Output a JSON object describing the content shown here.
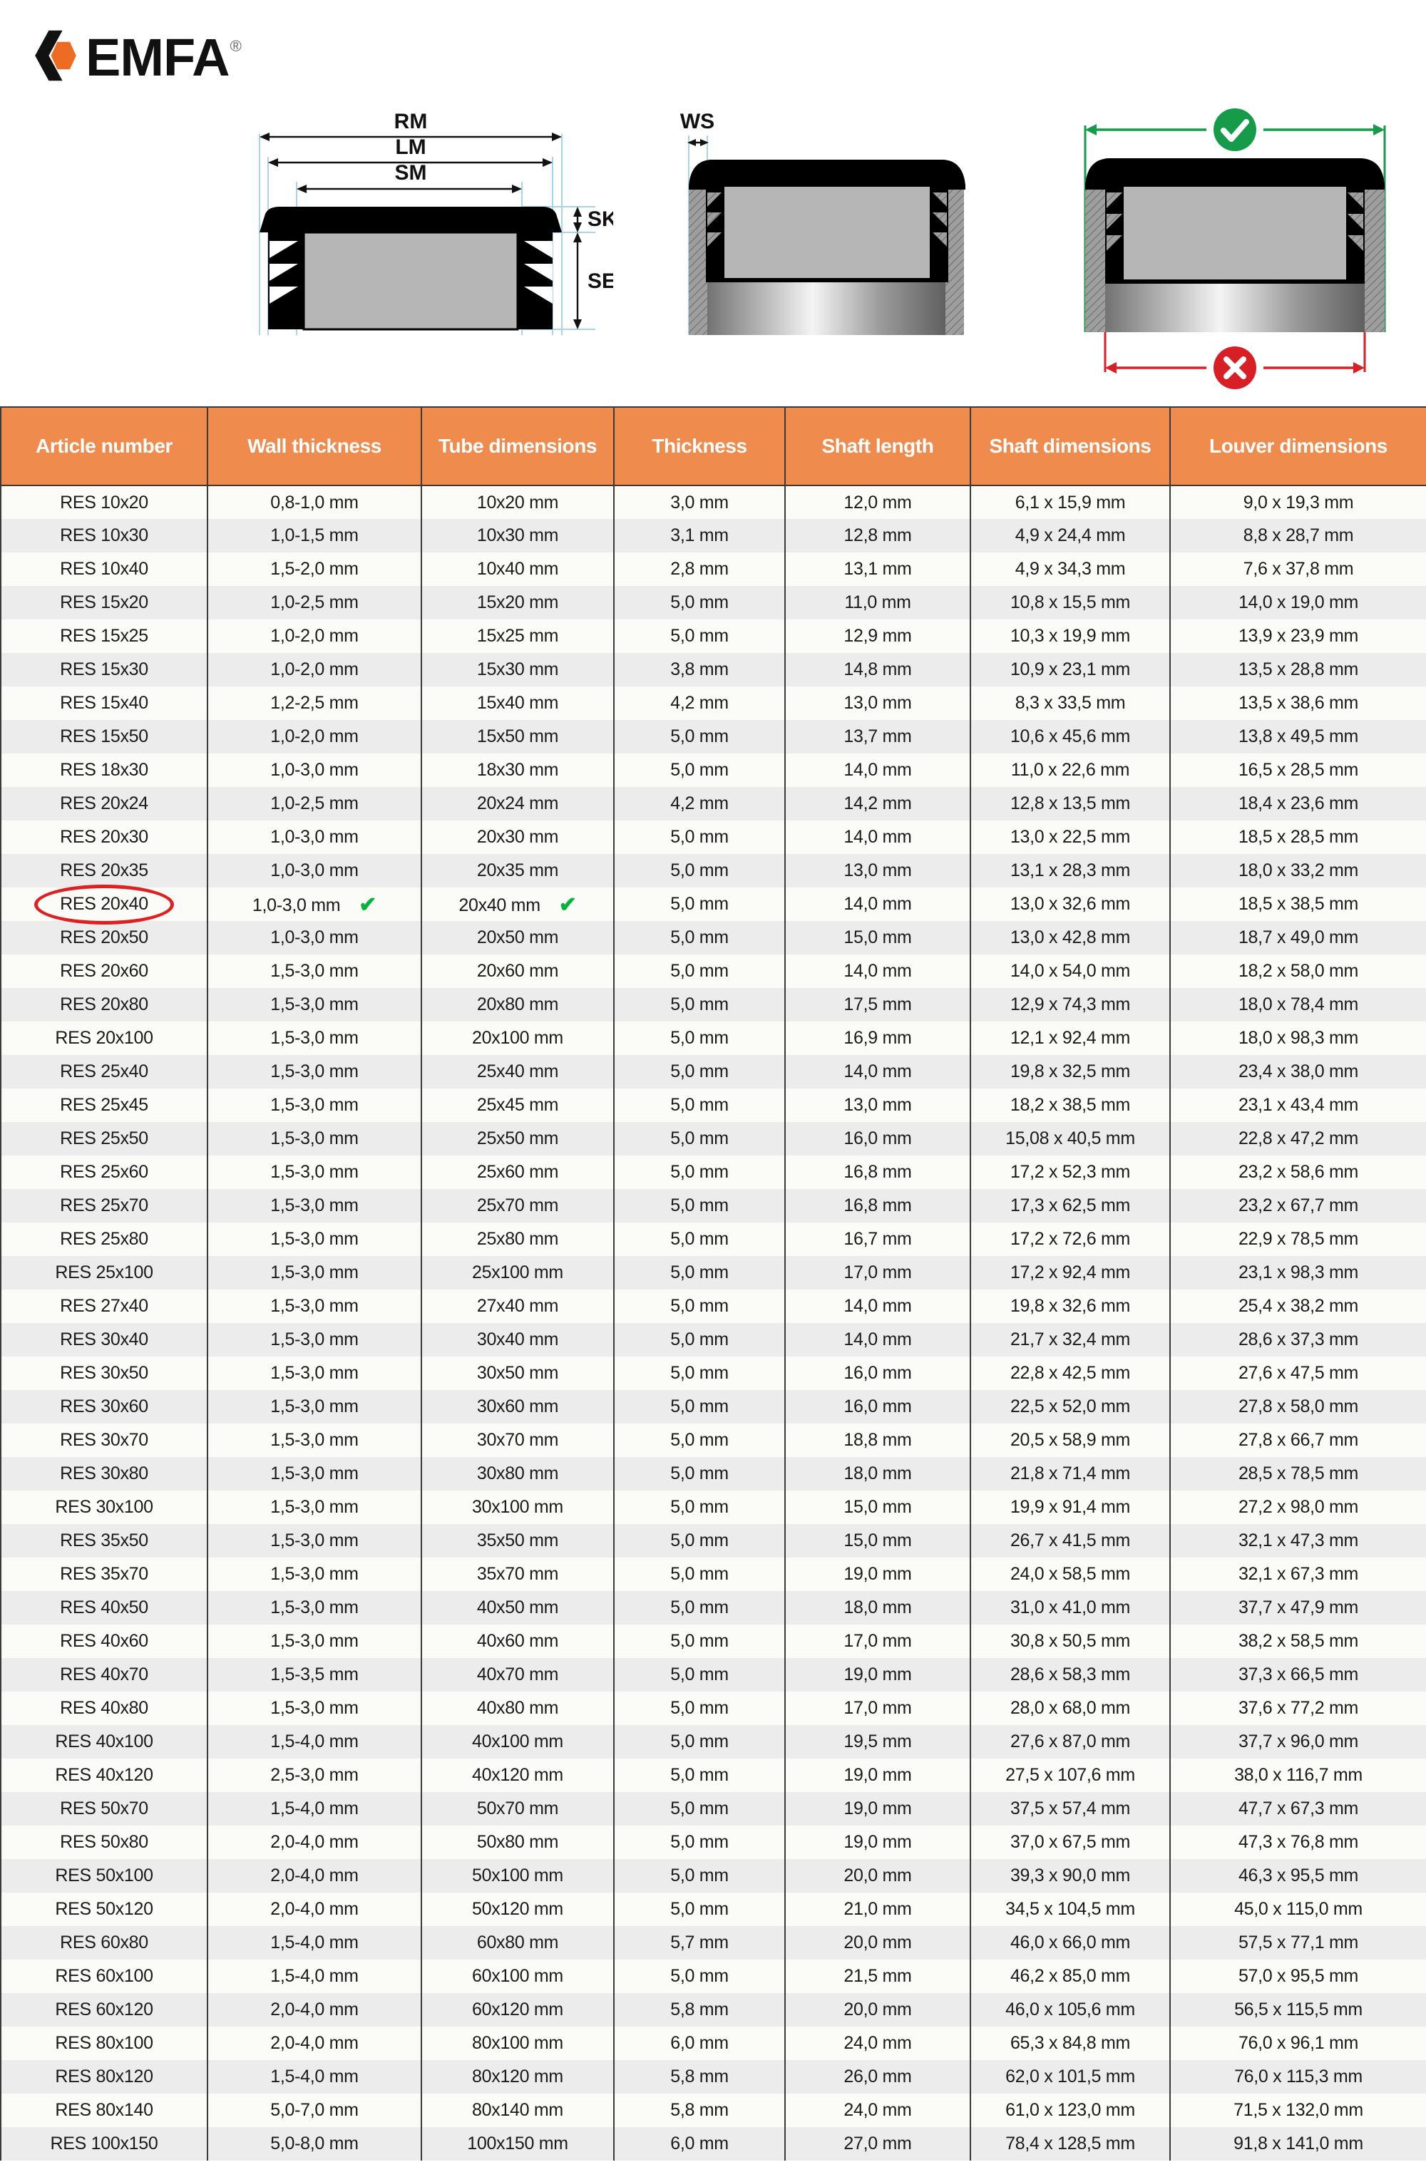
{
  "brand": {
    "name": "EMFA",
    "registered_mark": "®",
    "logo_icon": "emfa-hexagon-logo",
    "accent_color": "#ED6B22"
  },
  "diagrams": {
    "diagram1": {
      "name": "cap-cross-section-dimensions",
      "labels": [
        "RM",
        "LM",
        "SM",
        "SK",
        "SE"
      ]
    },
    "diagram2": {
      "name": "cap-in-tube-wall-thickness",
      "labels": [
        "WS"
      ]
    },
    "diagram3": {
      "name": "cap-fit-check",
      "labels": [],
      "icons": [
        "check-circle-icon",
        "cross-circle-icon"
      ],
      "ok_color": "#169b4b",
      "bad_color": "#d81f26"
    }
  },
  "table": {
    "name": "rectangular-end-cap-specification-table",
    "headers": [
      "Article number",
      "Wall thickness",
      "Tube dimensions",
      "Thickness",
      "Shaft length",
      "Shaft dimensions",
      "Louver dimensions"
    ],
    "highlight": {
      "article": "RES 20x40",
      "marker": "red-ellipse",
      "tick_glyph": "✔",
      "tick_columns": [
        "Wall thickness",
        "Tube dimensions"
      ]
    },
    "rows": [
      [
        "RES 10x20",
        "0,8-1,0 mm",
        "10x20 mm",
        "3,0 mm",
        "12,0 mm",
        "6,1 x 15,9 mm",
        "9,0 x 19,3 mm"
      ],
      [
        "RES 10x30",
        "1,0-1,5 mm",
        "10x30 mm",
        "3,1 mm",
        "12,8 mm",
        "4,9 x 24,4 mm",
        "8,8 x 28,7 mm"
      ],
      [
        "RES 10x40",
        "1,5-2,0 mm",
        "10x40 mm",
        "2,8 mm",
        "13,1 mm",
        "4,9 x 34,3 mm",
        "7,6 x 37,8 mm"
      ],
      [
        "RES 15x20",
        "1,0-2,5 mm",
        "15x20 mm",
        "5,0 mm",
        "11,0 mm",
        "10,8 x 15,5 mm",
        "14,0 x 19,0 mm"
      ],
      [
        "RES 15x25",
        "1,0-2,0 mm",
        "15x25 mm",
        "5,0 mm",
        "12,9 mm",
        "10,3 x 19,9 mm",
        "13,9 x 23,9 mm"
      ],
      [
        "RES 15x30",
        "1,0-2,0 mm",
        "15x30 mm",
        "3,8 mm",
        "14,8 mm",
        "10,9 x 23,1 mm",
        "13,5 x 28,8 mm"
      ],
      [
        "RES 15x40",
        "1,2-2,5 mm",
        "15x40 mm",
        "4,2 mm",
        "13,0 mm",
        "8,3 x 33,5 mm",
        "13,5 x 38,6 mm"
      ],
      [
        "RES 15x50",
        "1,0-2,0 mm",
        "15x50 mm",
        "5,0 mm",
        "13,7 mm",
        "10,6 x 45,6 mm",
        "13,8 x 49,5 mm"
      ],
      [
        "RES 18x30",
        "1,0-3,0 mm",
        "18x30 mm",
        "5,0 mm",
        "14,0 mm",
        "11,0 x 22,6 mm",
        "16,5 x 28,5 mm"
      ],
      [
        "RES 20x24",
        "1,0-2,5 mm",
        "20x24 mm",
        "4,2 mm",
        "14,2 mm",
        "12,8 x 13,5 mm",
        "18,4 x 23,6 mm"
      ],
      [
        "RES 20x30",
        "1,0-3,0 mm",
        "20x30 mm",
        "5,0 mm",
        "14,0 mm",
        "13,0 x 22,5 mm",
        "18,5 x 28,5 mm"
      ],
      [
        "RES 20x35",
        "1,0-3,0 mm",
        "20x35 mm",
        "5,0 mm",
        "13,0 mm",
        "13,1 x 28,3 mm",
        "18,0 x 33,2 mm"
      ],
      [
        "RES 20x40",
        "1,0-3,0 mm",
        "20x40 mm",
        "5,0 mm",
        "14,0 mm",
        "13,0 x 32,6 mm",
        "18,5 x 38,5 mm"
      ],
      [
        "RES 20x50",
        "1,0-3,0 mm",
        "20x50 mm",
        "5,0 mm",
        "15,0 mm",
        "13,0 x 42,8 mm",
        "18,7 x 49,0 mm"
      ],
      [
        "RES 20x60",
        "1,5-3,0 mm",
        "20x60 mm",
        "5,0 mm",
        "14,0 mm",
        "14,0 x 54,0 mm",
        "18,2 x 58,0 mm"
      ],
      [
        "RES 20x80",
        "1,5-3,0 mm",
        "20x80 mm",
        "5,0 mm",
        "17,5 mm",
        "12,9 x 74,3 mm",
        "18,0 x 78,4 mm"
      ],
      [
        "RES 20x100",
        "1,5-3,0 mm",
        "20x100 mm",
        "5,0 mm",
        "16,9 mm",
        "12,1 x 92,4 mm",
        "18,0 x 98,3 mm"
      ],
      [
        "RES 25x40",
        "1,5-3,0 mm",
        "25x40 mm",
        "5,0 mm",
        "14,0 mm",
        "19,8 x 32,5 mm",
        "23,4 x 38,0 mm"
      ],
      [
        "RES 25x45",
        "1,5-3,0 mm",
        "25x45 mm",
        "5,0 mm",
        "13,0 mm",
        "18,2 x 38,5 mm",
        "23,1 x 43,4 mm"
      ],
      [
        "RES 25x50",
        "1,5-3,0 mm",
        "25x50 mm",
        "5,0 mm",
        "16,0 mm",
        "15,08 x 40,5 mm",
        "22,8 x 47,2 mm"
      ],
      [
        "RES 25x60",
        "1,5-3,0 mm",
        "25x60 mm",
        "5,0 mm",
        "16,8 mm",
        "17,2 x 52,3 mm",
        "23,2 x 58,6 mm"
      ],
      [
        "RES 25x70",
        "1,5-3,0 mm",
        "25x70 mm",
        "5,0 mm",
        "16,8 mm",
        "17,3 x 62,5 mm",
        "23,2 x 67,7 mm"
      ],
      [
        "RES 25x80",
        "1,5-3,0 mm",
        "25x80 mm",
        "5,0 mm",
        "16,7 mm",
        "17,2 x 72,6 mm",
        "22,9 x 78,5 mm"
      ],
      [
        "RES 25x100",
        "1,5-3,0 mm",
        "25x100 mm",
        "5,0 mm",
        "17,0 mm",
        "17,2 x 92,4 mm",
        "23,1 x 98,3 mm"
      ],
      [
        "RES 27x40",
        "1,5-3,0 mm",
        "27x40 mm",
        "5,0 mm",
        "14,0 mm",
        "19,8 x 32,6 mm",
        "25,4 x 38,2 mm"
      ],
      [
        "RES 30x40",
        "1,5-3,0 mm",
        "30x40 mm",
        "5,0 mm",
        "14,0 mm",
        "21,7 x 32,4 mm",
        "28,6 x 37,3 mm"
      ],
      [
        "RES 30x50",
        "1,5-3,0 mm",
        "30x50 mm",
        "5,0 mm",
        "16,0 mm",
        "22,8 x 42,5 mm",
        "27,6 x 47,5 mm"
      ],
      [
        "RES 30x60",
        "1,5-3,0 mm",
        "30x60 mm",
        "5,0 mm",
        "16,0 mm",
        "22,5 x 52,0 mm",
        "27,8 x 58,0 mm"
      ],
      [
        "RES 30x70",
        "1,5-3,0 mm",
        "30x70 mm",
        "5,0 mm",
        "18,8 mm",
        "20,5 x 58,9 mm",
        "27,8 x 66,7 mm"
      ],
      [
        "RES 30x80",
        "1,5-3,0 mm",
        "30x80 mm",
        "5,0 mm",
        "18,0 mm",
        "21,8 x 71,4 mm",
        "28,5 x 78,5 mm"
      ],
      [
        "RES 30x100",
        "1,5-3,0 mm",
        "30x100 mm",
        "5,0 mm",
        "15,0 mm",
        "19,9 x 91,4 mm",
        "27,2 x 98,0 mm"
      ],
      [
        "RES 35x50",
        "1,5-3,0 mm",
        "35x50 mm",
        "5,0 mm",
        "15,0 mm",
        "26,7 x 41,5 mm",
        "32,1 x 47,3 mm"
      ],
      [
        "RES 35x70",
        "1,5-3,0 mm",
        "35x70 mm",
        "5,0 mm",
        "19,0 mm",
        "24,0 x 58,5 mm",
        "32,1 x 67,3 mm"
      ],
      [
        "RES 40x50",
        "1,5-3,0 mm",
        "40x50 mm",
        "5,0 mm",
        "18,0 mm",
        "31,0 x 41,0 mm",
        "37,7 x 47,9 mm"
      ],
      [
        "RES 40x60",
        "1,5-3,0 mm",
        "40x60 mm",
        "5,0 mm",
        "17,0 mm",
        "30,8 x 50,5 mm",
        "38,2 x 58,5 mm"
      ],
      [
        "RES 40x70",
        "1,5-3,5 mm",
        "40x70 mm",
        "5,0 mm",
        "19,0 mm",
        "28,6 x 58,3 mm",
        "37,3 x 66,5 mm"
      ],
      [
        "RES 40x80",
        "1,5-3,0 mm",
        "40x80 mm",
        "5,0 mm",
        "17,0 mm",
        "28,0 x 68,0 mm",
        "37,6 x 77,2 mm"
      ],
      [
        "RES 40x100",
        "1,5-4,0 mm",
        "40x100 mm",
        "5,0 mm",
        "19,5 mm",
        "27,6 x 87,0 mm",
        "37,7 x 96,0 mm"
      ],
      [
        "RES 40x120",
        "2,5-3,0 mm",
        "40x120 mm",
        "5,0 mm",
        "19,0 mm",
        "27,5 x 107,6 mm",
        "38,0 x 116,7 mm"
      ],
      [
        "RES 50x70",
        "1,5-4,0 mm",
        "50x70 mm",
        "5,0 mm",
        "19,0 mm",
        "37,5 x 57,4 mm",
        "47,7 x 67,3 mm"
      ],
      [
        "RES 50x80",
        "2,0-4,0 mm",
        "50x80 mm",
        "5,0 mm",
        "19,0 mm",
        "37,0 x 67,5 mm",
        "47,3 x 76,8 mm"
      ],
      [
        "RES 50x100",
        "2,0-4,0 mm",
        "50x100 mm",
        "5,0 mm",
        "20,0 mm",
        "39,3 x 90,0 mm",
        "46,3 x 95,5 mm"
      ],
      [
        "RES 50x120",
        "2,0-4,0 mm",
        "50x120 mm",
        "5,0 mm",
        "21,0 mm",
        "34,5 x 104,5 mm",
        "45,0 x 115,0 mm"
      ],
      [
        "RES 60x80",
        "1,5-4,0 mm",
        "60x80 mm",
        "5,7 mm",
        "20,0 mm",
        "46,0 x 66,0 mm",
        "57,5 x 77,1 mm"
      ],
      [
        "RES 60x100",
        "1,5-4,0 mm",
        "60x100 mm",
        "5,0 mm",
        "21,5 mm",
        "46,2 x 85,0 mm",
        "57,0 x 95,5 mm"
      ],
      [
        "RES 60x120",
        "2,0-4,0 mm",
        "60x120 mm",
        "5,8 mm",
        "20,0 mm",
        "46,0 x 105,6 mm",
        "56,5 x 115,5 mm"
      ],
      [
        "RES 80x100",
        "2,0-4,0 mm",
        "80x100 mm",
        "6,0 mm",
        "24,0 mm",
        "65,3 x 84,8 mm",
        "76,0 x 96,1 mm"
      ],
      [
        "RES 80x120",
        "1,5-4,0 mm",
        "80x120 mm",
        "5,8 mm",
        "26,0 mm",
        "62,0 x 101,5 mm",
        "76,0 x 115,3 mm"
      ],
      [
        "RES 80x140",
        "5,0-7,0 mm",
        "80x140 mm",
        "5,8 mm",
        "24,0 mm",
        "61,0 x 123,0 mm",
        "71,5 x 132,0 mm"
      ],
      [
        "RES 100x150",
        "5,0-8,0 mm",
        "100x150 mm",
        "6,0 mm",
        "27,0 mm",
        "78,4 x 128,5 mm",
        "91,8 x 141,0 mm"
      ]
    ]
  }
}
